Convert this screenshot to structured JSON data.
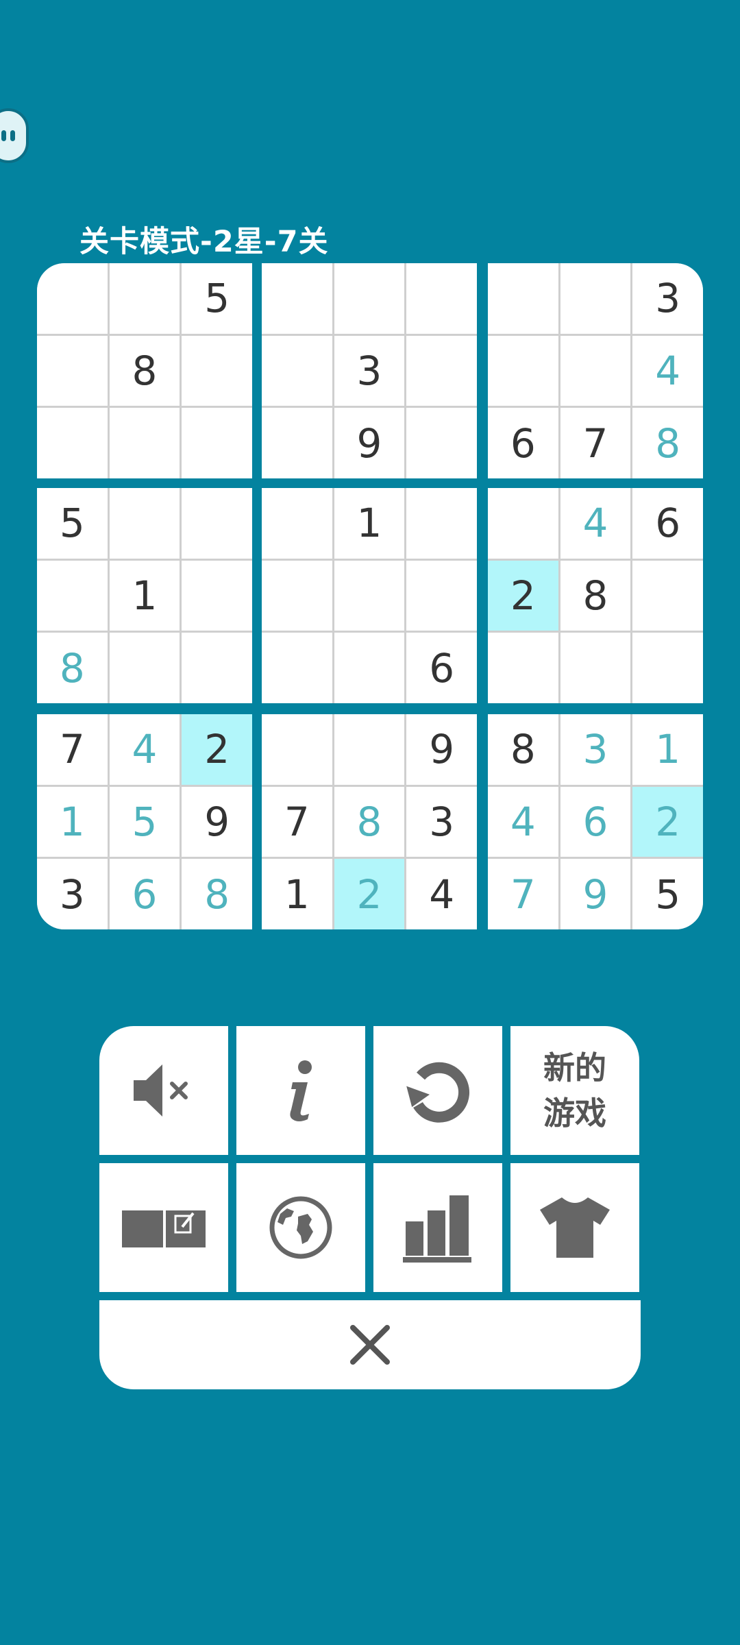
{
  "level_title": "关卡模式-2星-7关",
  "colors": {
    "background": "#03839f",
    "given_digit": "#333333",
    "user_digit": "#4fb3bd",
    "highlight": "#b2f6fa",
    "icon": "#666666"
  },
  "grid": [
    [
      "",
      "",
      "5",
      "",
      "",
      "",
      "",
      "",
      "3"
    ],
    [
      "",
      "8",
      "",
      "",
      "3",
      "",
      "",
      "",
      "4"
    ],
    [
      "",
      "",
      "",
      "",
      "9",
      "",
      "6",
      "7",
      "8"
    ],
    [
      "5",
      "",
      "",
      "",
      "1",
      "",
      "",
      "4",
      "6"
    ],
    [
      "",
      "1",
      "",
      "",
      "",
      "",
      "2",
      "8",
      ""
    ],
    [
      "8",
      "",
      "",
      "",
      "",
      "6",
      "",
      "",
      ""
    ],
    [
      "7",
      "4",
      "2",
      "",
      "",
      "9",
      "8",
      "3",
      "1"
    ],
    [
      "1",
      "5",
      "9",
      "7",
      "8",
      "3",
      "4",
      "6",
      "2"
    ],
    [
      "3",
      "6",
      "8",
      "1",
      "2",
      "4",
      "7",
      "9",
      "5"
    ]
  ],
  "user_entered": [
    [
      1,
      8
    ],
    [
      2,
      8
    ],
    [
      3,
      7
    ],
    [
      5,
      0
    ],
    [
      6,
      1
    ],
    [
      6,
      7
    ],
    [
      6,
      8
    ],
    [
      7,
      0
    ],
    [
      7,
      1
    ],
    [
      7,
      4
    ],
    [
      7,
      6
    ],
    [
      7,
      7
    ],
    [
      7,
      8
    ],
    [
      8,
      1
    ],
    [
      8,
      2
    ],
    [
      8,
      4
    ],
    [
      8,
      6
    ],
    [
      8,
      7
    ]
  ],
  "highlighted": [
    [
      4,
      6
    ],
    [
      6,
      2
    ],
    [
      7,
      8
    ],
    [
      8,
      4
    ]
  ],
  "menu": {
    "mute_icon": "speaker-muted-icon",
    "info_icon": "info-icon",
    "restart_icon": "restart-icon",
    "new_game_label": "新的游戏",
    "notes_icon": "notes-toggle-icon",
    "globe_icon": "globe-icon",
    "stats_icon": "bar-chart-icon",
    "theme_icon": "tshirt-icon",
    "close_icon": "close-icon"
  }
}
